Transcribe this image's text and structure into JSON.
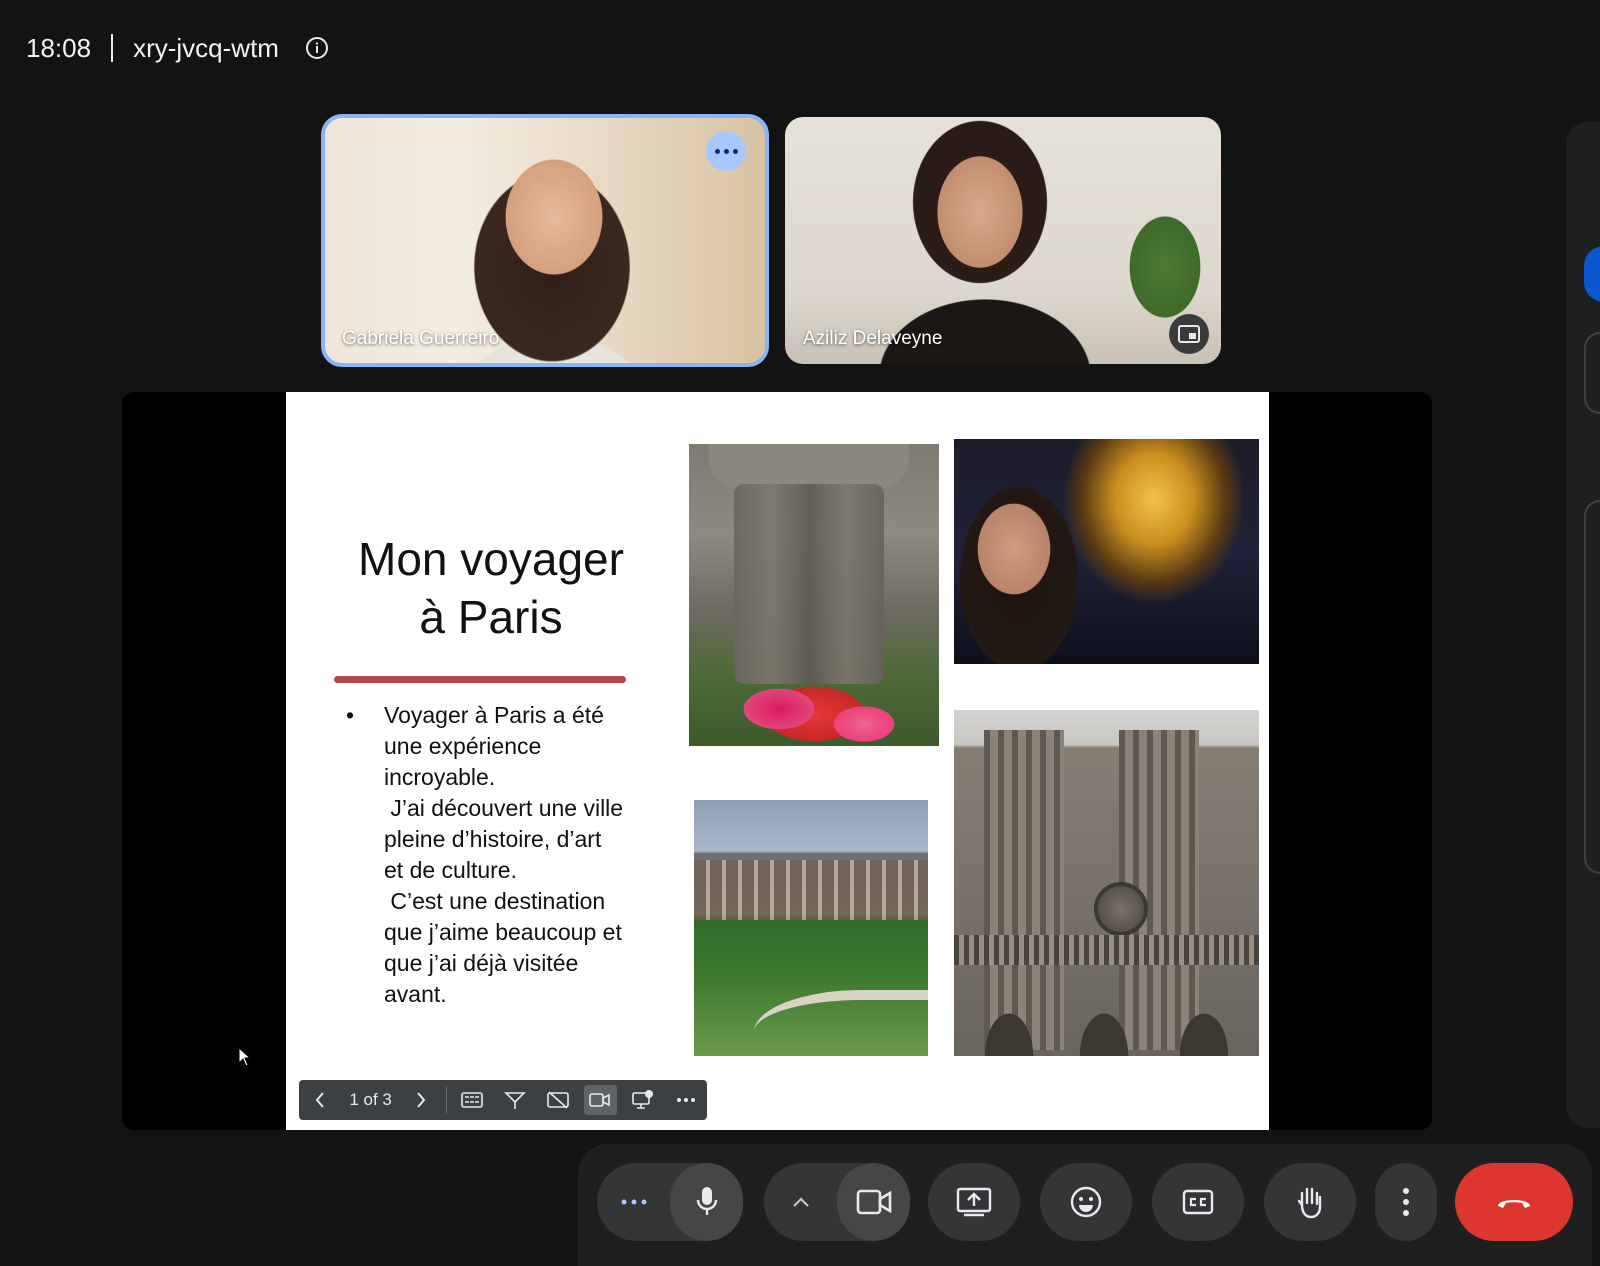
{
  "header": {
    "time": "18:08",
    "meeting_code": "xry-jvcq-wtm",
    "info_icon": "info-icon"
  },
  "participants": [
    {
      "name": "Gabriela Guerreiro",
      "highlighted": true
    },
    {
      "name": "Aziliz Delaveyne",
      "highlighted": false
    }
  ],
  "slide": {
    "title_line1": "Mon voyager",
    "title_line2": "à Paris",
    "bullet_lines": [
      "Voyager à Paris a été",
      "une expérience",
      "incroyable.",
      " J’ai découvert une ville",
      "pleine d’histoire, d’art",
      "et de culture.",
      " C’est une destination",
      "que j’aime beaucoup et",
      "que j’ai déjà visitée",
      "avant."
    ],
    "accent_color": "#b3474e"
  },
  "slide_controls": {
    "page_indicator": "1 of 3"
  },
  "controls": {
    "end_call_color": "#dc362e",
    "highlight_color": "#8ab4f8"
  }
}
